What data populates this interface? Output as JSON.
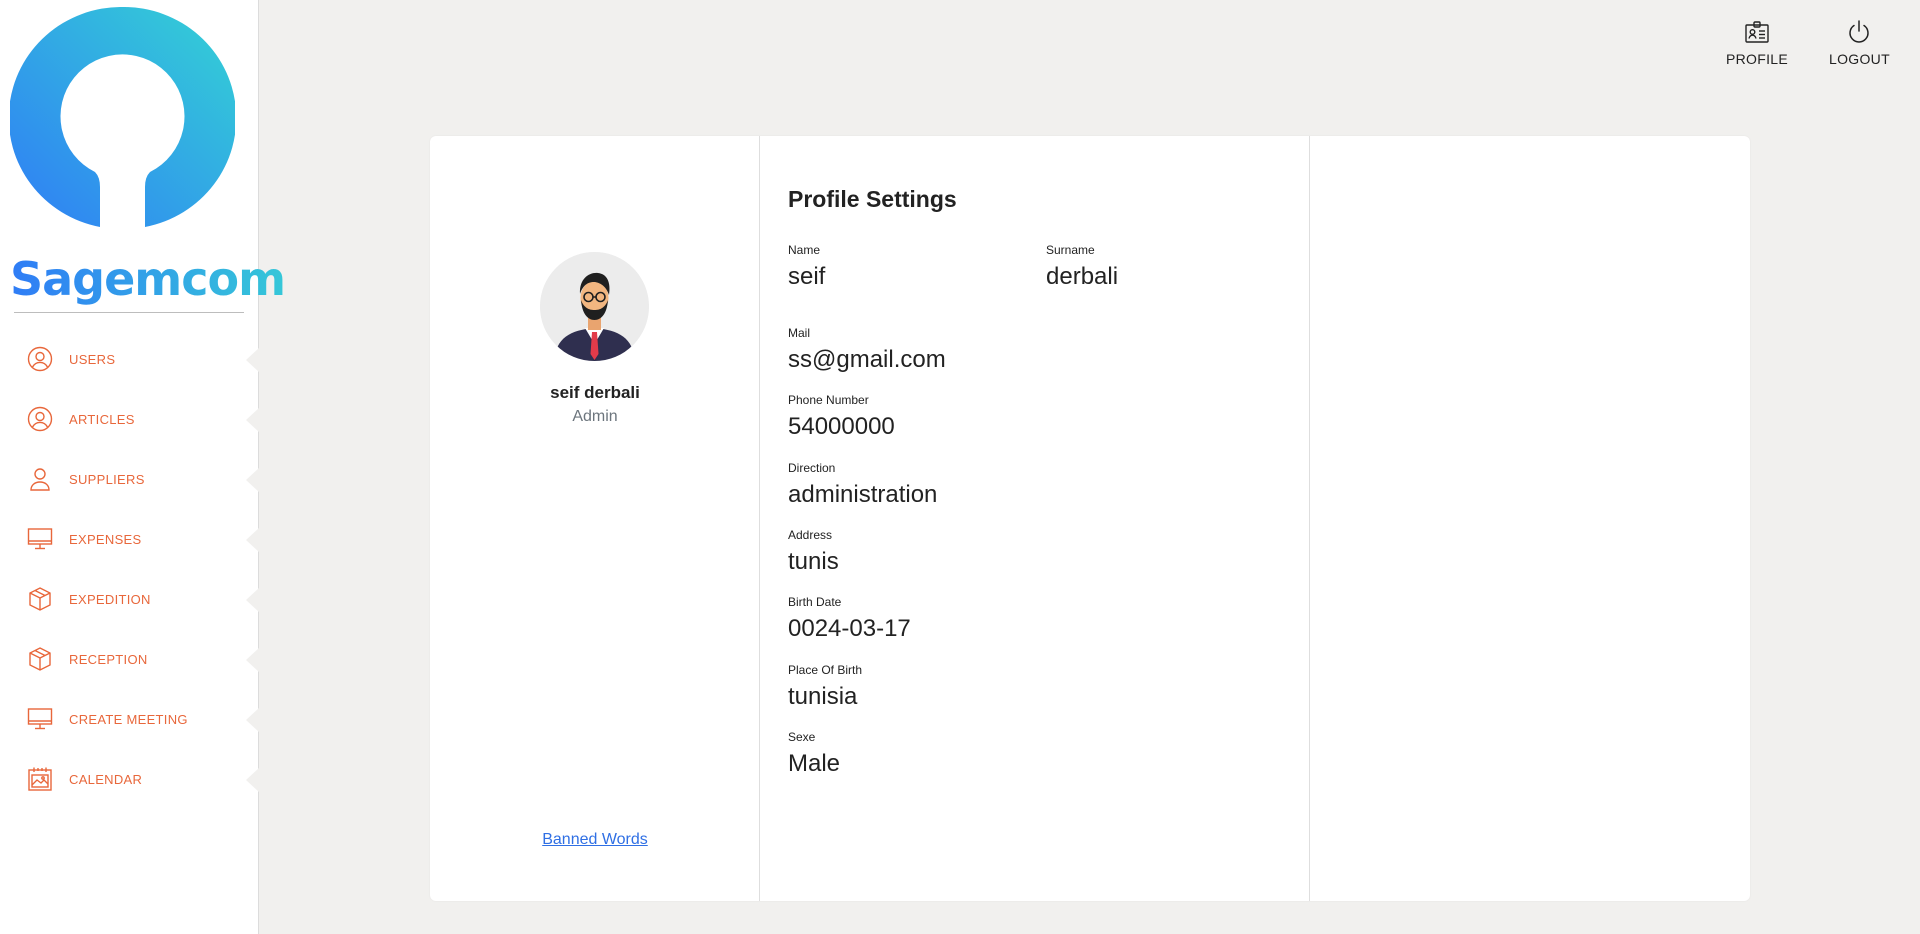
{
  "brand": {
    "name": "Sagemcom",
    "colors": {
      "gradient_start": "#2f7cf6",
      "gradient_end": "#35c7d8",
      "accent": "#e8673b",
      "link": "#2f6fe4"
    }
  },
  "sidebar": {
    "items": [
      {
        "label": "USERS",
        "icon": "user-circle-icon"
      },
      {
        "label": "ARTICLES",
        "icon": "user-circle-icon"
      },
      {
        "label": "SUPPLIERS",
        "icon": "user-icon"
      },
      {
        "label": "EXPENSES",
        "icon": "monitor-icon"
      },
      {
        "label": "EXPEDITION",
        "icon": "box-icon"
      },
      {
        "label": "RECEPTION",
        "icon": "box-icon"
      },
      {
        "label": "CREATE MEETING",
        "icon": "monitor-icon"
      },
      {
        "label": "CALENDAR",
        "icon": "calendar-icon"
      }
    ]
  },
  "header": {
    "profile_label": "PROFILE",
    "logout_label": "LOGOUT"
  },
  "profile_card": {
    "full_name": "seif derbali",
    "role": "Admin",
    "banned_words_link": "Banned Words"
  },
  "settings": {
    "title": "Profile Settings",
    "name": {
      "label": "Name",
      "value": "seif"
    },
    "surname": {
      "label": "Surname",
      "value": "derbali"
    },
    "mail": {
      "label": "Mail",
      "value": "ss@gmail.com"
    },
    "phone": {
      "label": "Phone Number",
      "value": "54000000"
    },
    "direction": {
      "label": "Direction",
      "value": "administration"
    },
    "address": {
      "label": "Address",
      "value": "tunis"
    },
    "birth_date": {
      "label": "Birth Date",
      "value": "0024-03-17"
    },
    "place_of_birth": {
      "label": "Place Of Birth",
      "value": "tunisia"
    },
    "sexe": {
      "label": "Sexe",
      "value": "Male"
    }
  }
}
